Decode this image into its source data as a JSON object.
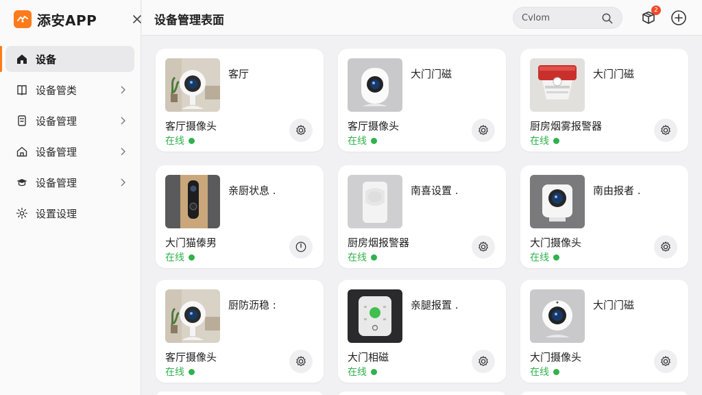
{
  "app": {
    "name": "添安APP"
  },
  "sidebar": {
    "items": [
      {
        "label": "设备",
        "icon": "home-icon",
        "active": true
      },
      {
        "label": "设备管类",
        "icon": "book-icon",
        "active": false
      },
      {
        "label": "设备管理",
        "icon": "device-panel-icon",
        "active": false
      },
      {
        "label": "设备管理",
        "icon": "house-icon",
        "active": false
      },
      {
        "label": "设备管理",
        "icon": "cap-icon",
        "active": false
      },
      {
        "label": "设置设理",
        "icon": "gear-icon",
        "active": false
      }
    ]
  },
  "header": {
    "title": "设备管理表面",
    "search": {
      "value": "Cvlom",
      "placeholder": "Cvlom"
    },
    "notification_count": "2"
  },
  "cards": [
    {
      "title": "客厅",
      "name": "客厅摄像头",
      "status": "在线",
      "thumb": "indoor-camera",
      "action_icon": "gear-icon"
    },
    {
      "title": "大门门磁",
      "name": "客厅摄像头",
      "status": "在线",
      "thumb": "dome-camera",
      "action_icon": "gear-icon"
    },
    {
      "title": "大门门磁",
      "name": "厨房烟雾报警器",
      "status": "在线",
      "thumb": "smoke-alarm",
      "action_icon": "gear-icon"
    },
    {
      "title": "亲厨状息 .",
      "name": "大门猫傣男",
      "status": "在线",
      "thumb": "video-doorbell",
      "action_icon": "power-icon"
    },
    {
      "title": "南喜设置 .",
      "name": "厨房烟报警器",
      "status": "在线",
      "thumb": "motion-sensor",
      "action_icon": "gear-icon"
    },
    {
      "title": "南由报者 .",
      "name": "大门摄像头",
      "status": "在线",
      "thumb": "cube-camera",
      "action_icon": "gear-icon"
    },
    {
      "title": "厨防沥稳 :",
      "name": "客厅摄像头",
      "status": "在线",
      "thumb": "indoor-camera",
      "action_icon": "gear-icon"
    },
    {
      "title": "亲腿报置 .",
      "name": "大门相磁",
      "status": "在线",
      "thumb": "hub-device",
      "action_icon": "gear-icon"
    },
    {
      "title": "大门门磁",
      "name": "大门摄像头",
      "status": "在线",
      "thumb": "dome-camera",
      "action_icon": "gear-icon"
    }
  ],
  "colors": {
    "accent": "#ff7a1a",
    "online": "#2fb24c",
    "badge": "#f04a2a"
  }
}
